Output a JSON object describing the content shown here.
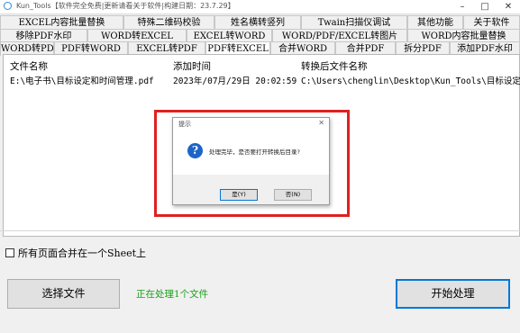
{
  "window": {
    "title": "Kun_Tools【软件完全免费|更新请看关于软件|构建日期：23.7.29】",
    "minimize": "–",
    "maximize": "□",
    "close": "✕"
  },
  "tabs": {
    "row1": [
      "EXCEL内容批量替换",
      "特殊二维码校验",
      "姓名横转竖列",
      "Twain扫描仪调试",
      "其他功能",
      "关于软件"
    ],
    "row2": [
      "移除PDF水印",
      "WORD转EXCEL",
      "EXCEL转WORD",
      "WORD/PDF/EXCEL转图片",
      "WORD内容批量替换"
    ],
    "row3": [
      "WORD转PDF",
      "PDF转WORD",
      "EXCEL转PDF",
      "PDF转EXCEL",
      "合并WORD",
      "合并PDF",
      "拆分PDF",
      "添加PDF水印"
    ],
    "active": "PDF转EXCEL"
  },
  "file_list": {
    "columns": [
      "文件名称",
      "添加时间",
      "转换后文件名称"
    ],
    "rows": [
      [
        "E:\\电子书\\目标设定和时间管理.pdf",
        "2023年/07月/29日 20:02:59",
        "C:\\Users\\chenglin\\Desktop\\Kun_Tools\\目标设定"
      ]
    ]
  },
  "options": {
    "merge_sheet_label": "所有页面合并在一个Sheet上",
    "merge_sheet_checked": false
  },
  "actions": {
    "select_file": "选择文件",
    "status": "正在处理1个文件",
    "start": "开始处理"
  },
  "dialog": {
    "title": "提示",
    "close": "✕",
    "icon": "info-icon",
    "message": "处理完毕，是否要打开转换后目录?",
    "yes": "是(Y)",
    "no": "否(N)"
  },
  "colors": {
    "status_green": "#19a019",
    "highlight_red": "#e02020",
    "info_blue": "#1e64c8"
  }
}
